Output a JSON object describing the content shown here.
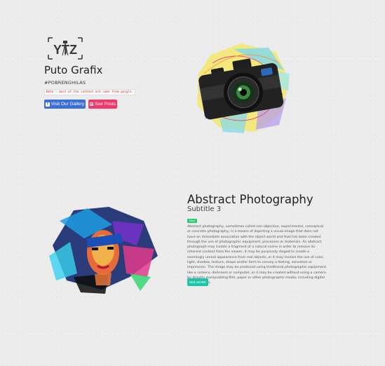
{
  "brand": {
    "logo_text": "YTZ",
    "title": "Puto Grafix",
    "tagline": "#POBRENGHILAS",
    "note": "Note : most of the content are came from google.",
    "buttons": {
      "gallery": "Visit Our Gallery",
      "posts": "See Posts"
    }
  },
  "section": {
    "title": "Abstract Photography",
    "subtitle": "Subtitle 3",
    "badge": "New",
    "description": "Abstract photography, sometimes called non-objective, experimental, conceptual or concrete photography, is a means of depicting a visual image that does not have an immediate association with the object world and that has been created through the use of photographic equipment, processes or materials. An abstract photograph may isolate a fragment of a natural scene in order to remove its inherent context from the viewer, it may be purposely staged to create a seemingly unreal appearance from real objects, or it may involve the use of color, light, shadow, texture, shape and/or form to convey a feeling, sensation or impression. The image may be produced using traditional photographic equipment like a camera, darkroom or computer, or it may be created without using a camera by directly manipulating film, paper or other photographic media, including digital presentations.",
    "cta": "SEE MORE"
  },
  "colors": {
    "gallery_button": "#3c6fd6",
    "posts_button": "#f0386c",
    "badge": "#2ecc71",
    "cta": "#1dc4a8"
  },
  "icons": [
    "facebook-icon",
    "instagram-icon"
  ]
}
